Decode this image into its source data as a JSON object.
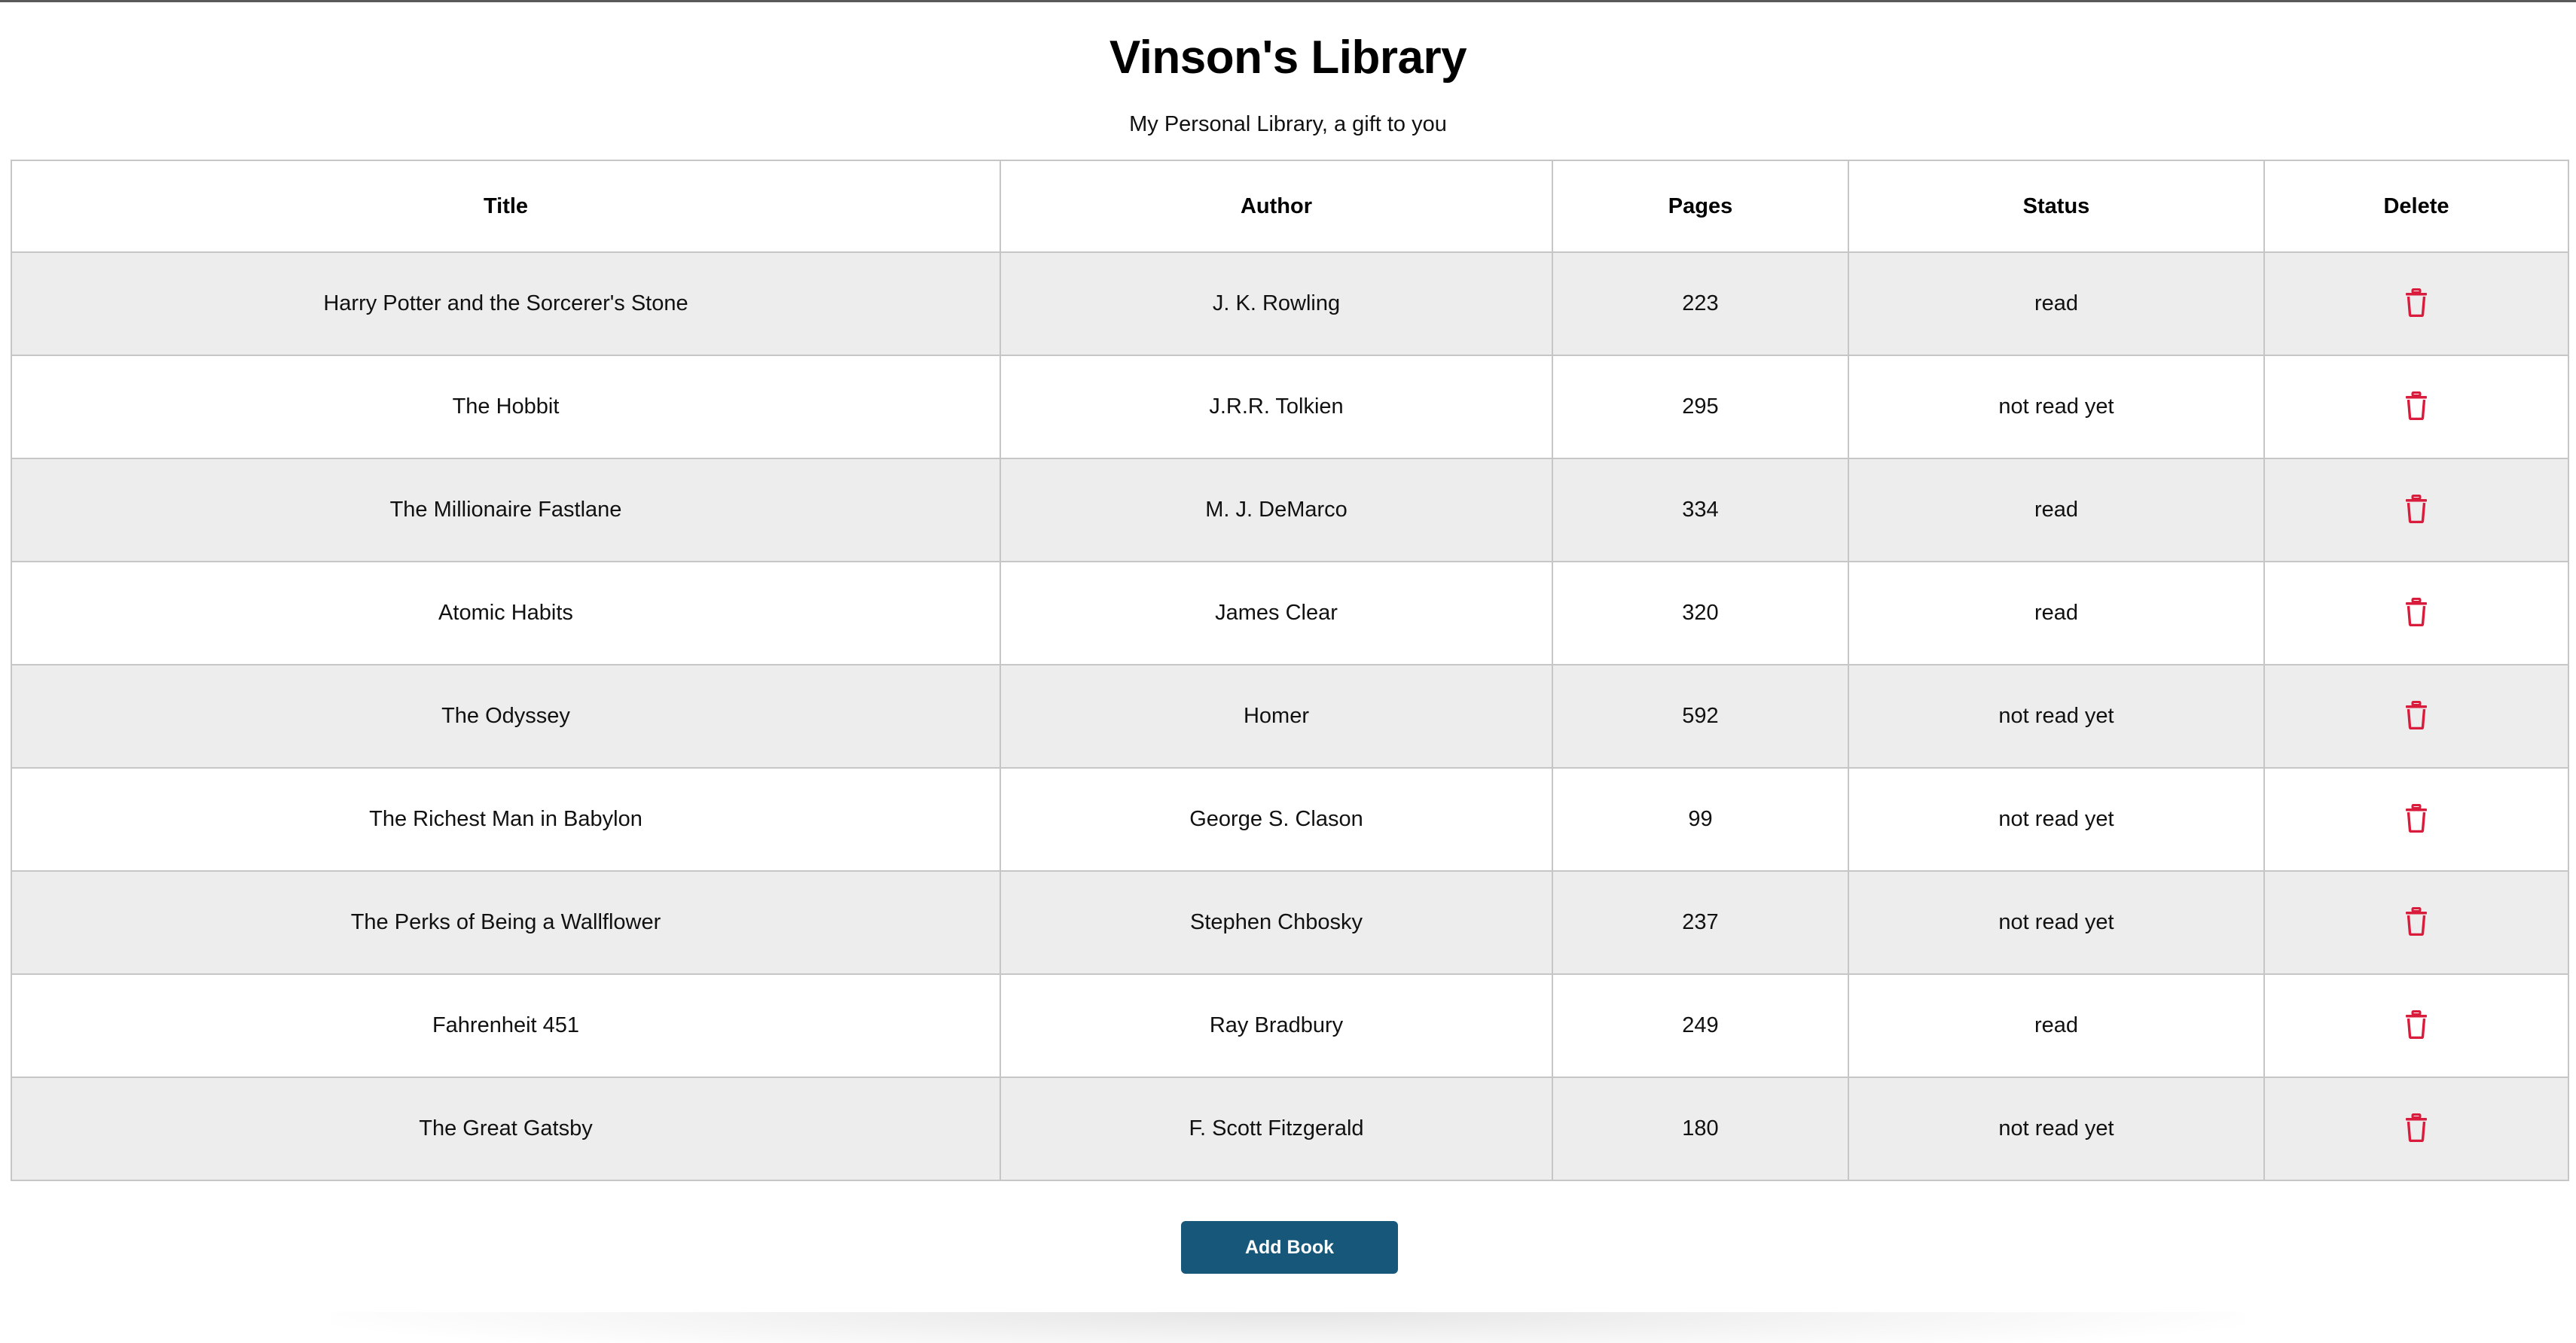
{
  "header": {
    "title": "Vinson's Library",
    "subtitle": "My Personal Library, a gift to you"
  },
  "table": {
    "columns": [
      "Title",
      "Author",
      "Pages",
      "Status",
      "Delete"
    ],
    "rows": [
      {
        "title": "Harry Potter and the Sorcerer's Stone",
        "author": "J. K. Rowling",
        "pages": "223",
        "status": "read"
      },
      {
        "title": "The Hobbit",
        "author": "J.R.R. Tolkien",
        "pages": "295",
        "status": "not read yet"
      },
      {
        "title": "The Millionaire Fastlane",
        "author": "M. J. DeMarco",
        "pages": "334",
        "status": "read"
      },
      {
        "title": "Atomic Habits",
        "author": "James Clear",
        "pages": "320",
        "status": "read"
      },
      {
        "title": "The Odyssey",
        "author": "Homer",
        "pages": "592",
        "status": "not read yet"
      },
      {
        "title": "The Richest Man in Babylon",
        "author": "George S. Clason",
        "pages": "99",
        "status": "not read yet"
      },
      {
        "title": "The Perks of Being a Wallflower",
        "author": "Stephen Chbosky",
        "pages": "237",
        "status": "not read yet"
      },
      {
        "title": "Fahrenheit 451",
        "author": "Ray Bradbury",
        "pages": "249",
        "status": "read"
      },
      {
        "title": "The Great Gatsby",
        "author": "F. Scott Fitzgerald",
        "pages": "180",
        "status": "not read yet"
      }
    ],
    "delete_icon": "trash-icon"
  },
  "actions": {
    "add_book_label": "Add Book"
  },
  "colors": {
    "accent": "#17587a",
    "delete_icon": "#d91b3c",
    "row_stripe": "#ededed",
    "border": "#c6c6c6"
  }
}
